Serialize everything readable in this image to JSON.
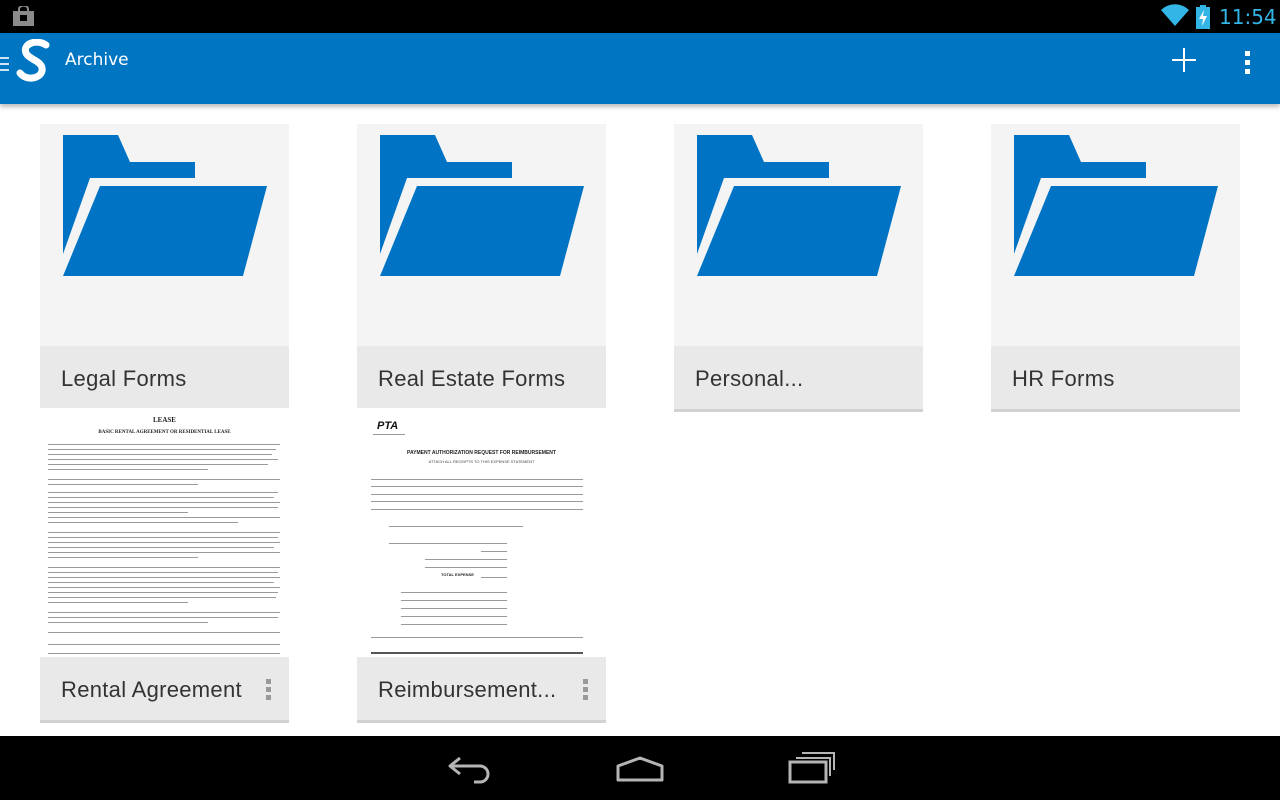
{
  "status_bar": {
    "time": "11:54",
    "icons": [
      "shopping-bag-icon",
      "wifi-icon",
      "battery-charging-icon"
    ],
    "clock_color": "#33b5e5"
  },
  "action_bar": {
    "title": "Archive",
    "background": "#0075c2",
    "icons": [
      "drawer-icon",
      "app-logo-icon",
      "add-icon",
      "overflow-menu-icon"
    ]
  },
  "folders": [
    {
      "name": "Legal Forms"
    },
    {
      "name": "Real Estate Forms"
    },
    {
      "name": "Personal..."
    },
    {
      "name": "HR Forms"
    }
  ],
  "documents": [
    {
      "name": "Rental Agreement",
      "preview_heading": "LEASE",
      "preview_subheading": "BASIC RENTAL AGREEMENT OR RESIDENTIAL LEASE"
    },
    {
      "name": "Reimbursement...",
      "preview_logo": "PTA",
      "preview_heading": "PAYMENT AUTHORIZATION REQUEST FOR REIMBURSEMENT",
      "preview_subheading": "ATTACH ALL RECEIPTS TO THIS EXPENSE STATEMENT",
      "preview_total": "TOTAL EXPENSE"
    }
  ],
  "nav_bar": {
    "icons": [
      "back-icon",
      "home-icon",
      "recent-apps-icon"
    ]
  },
  "colors": {
    "folder": "#0073c4",
    "tile_background": "#f4f4f4",
    "caption_background": "#e9e9e9"
  }
}
